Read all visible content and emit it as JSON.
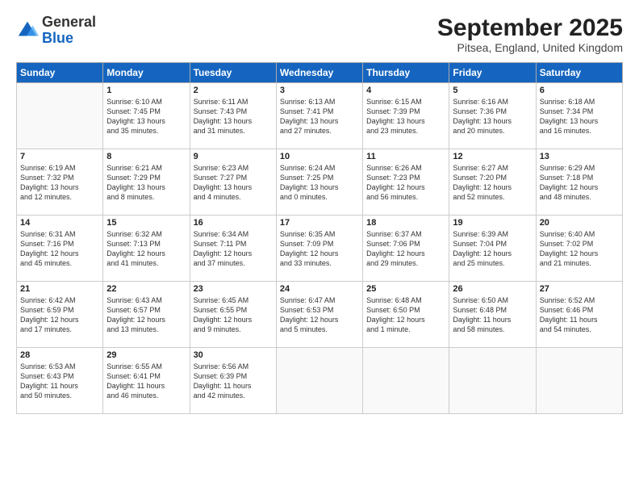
{
  "header": {
    "logo_general": "General",
    "logo_blue": "Blue",
    "month_title": "September 2025",
    "subtitle": "Pitsea, England, United Kingdom"
  },
  "weekdays": [
    "Sunday",
    "Monday",
    "Tuesday",
    "Wednesday",
    "Thursday",
    "Friday",
    "Saturday"
  ],
  "weeks": [
    [
      {
        "day": "",
        "lines": []
      },
      {
        "day": "1",
        "lines": [
          "Sunrise: 6:10 AM",
          "Sunset: 7:45 PM",
          "Daylight: 13 hours",
          "and 35 minutes."
        ]
      },
      {
        "day": "2",
        "lines": [
          "Sunrise: 6:11 AM",
          "Sunset: 7:43 PM",
          "Daylight: 13 hours",
          "and 31 minutes."
        ]
      },
      {
        "day": "3",
        "lines": [
          "Sunrise: 6:13 AM",
          "Sunset: 7:41 PM",
          "Daylight: 13 hours",
          "and 27 minutes."
        ]
      },
      {
        "day": "4",
        "lines": [
          "Sunrise: 6:15 AM",
          "Sunset: 7:39 PM",
          "Daylight: 13 hours",
          "and 23 minutes."
        ]
      },
      {
        "day": "5",
        "lines": [
          "Sunrise: 6:16 AM",
          "Sunset: 7:36 PM",
          "Daylight: 13 hours",
          "and 20 minutes."
        ]
      },
      {
        "day": "6",
        "lines": [
          "Sunrise: 6:18 AM",
          "Sunset: 7:34 PM",
          "Daylight: 13 hours",
          "and 16 minutes."
        ]
      }
    ],
    [
      {
        "day": "7",
        "lines": [
          "Sunrise: 6:19 AM",
          "Sunset: 7:32 PM",
          "Daylight: 13 hours",
          "and 12 minutes."
        ]
      },
      {
        "day": "8",
        "lines": [
          "Sunrise: 6:21 AM",
          "Sunset: 7:29 PM",
          "Daylight: 13 hours",
          "and 8 minutes."
        ]
      },
      {
        "day": "9",
        "lines": [
          "Sunrise: 6:23 AM",
          "Sunset: 7:27 PM",
          "Daylight: 13 hours",
          "and 4 minutes."
        ]
      },
      {
        "day": "10",
        "lines": [
          "Sunrise: 6:24 AM",
          "Sunset: 7:25 PM",
          "Daylight: 13 hours",
          "and 0 minutes."
        ]
      },
      {
        "day": "11",
        "lines": [
          "Sunrise: 6:26 AM",
          "Sunset: 7:23 PM",
          "Daylight: 12 hours",
          "and 56 minutes."
        ]
      },
      {
        "day": "12",
        "lines": [
          "Sunrise: 6:27 AM",
          "Sunset: 7:20 PM",
          "Daylight: 12 hours",
          "and 52 minutes."
        ]
      },
      {
        "day": "13",
        "lines": [
          "Sunrise: 6:29 AM",
          "Sunset: 7:18 PM",
          "Daylight: 12 hours",
          "and 48 minutes."
        ]
      }
    ],
    [
      {
        "day": "14",
        "lines": [
          "Sunrise: 6:31 AM",
          "Sunset: 7:16 PM",
          "Daylight: 12 hours",
          "and 45 minutes."
        ]
      },
      {
        "day": "15",
        "lines": [
          "Sunrise: 6:32 AM",
          "Sunset: 7:13 PM",
          "Daylight: 12 hours",
          "and 41 minutes."
        ]
      },
      {
        "day": "16",
        "lines": [
          "Sunrise: 6:34 AM",
          "Sunset: 7:11 PM",
          "Daylight: 12 hours",
          "and 37 minutes."
        ]
      },
      {
        "day": "17",
        "lines": [
          "Sunrise: 6:35 AM",
          "Sunset: 7:09 PM",
          "Daylight: 12 hours",
          "and 33 minutes."
        ]
      },
      {
        "day": "18",
        "lines": [
          "Sunrise: 6:37 AM",
          "Sunset: 7:06 PM",
          "Daylight: 12 hours",
          "and 29 minutes."
        ]
      },
      {
        "day": "19",
        "lines": [
          "Sunrise: 6:39 AM",
          "Sunset: 7:04 PM",
          "Daylight: 12 hours",
          "and 25 minutes."
        ]
      },
      {
        "day": "20",
        "lines": [
          "Sunrise: 6:40 AM",
          "Sunset: 7:02 PM",
          "Daylight: 12 hours",
          "and 21 minutes."
        ]
      }
    ],
    [
      {
        "day": "21",
        "lines": [
          "Sunrise: 6:42 AM",
          "Sunset: 6:59 PM",
          "Daylight: 12 hours",
          "and 17 minutes."
        ]
      },
      {
        "day": "22",
        "lines": [
          "Sunrise: 6:43 AM",
          "Sunset: 6:57 PM",
          "Daylight: 12 hours",
          "and 13 minutes."
        ]
      },
      {
        "day": "23",
        "lines": [
          "Sunrise: 6:45 AM",
          "Sunset: 6:55 PM",
          "Daylight: 12 hours",
          "and 9 minutes."
        ]
      },
      {
        "day": "24",
        "lines": [
          "Sunrise: 6:47 AM",
          "Sunset: 6:53 PM",
          "Daylight: 12 hours",
          "and 5 minutes."
        ]
      },
      {
        "day": "25",
        "lines": [
          "Sunrise: 6:48 AM",
          "Sunset: 6:50 PM",
          "Daylight: 12 hours",
          "and 1 minute."
        ]
      },
      {
        "day": "26",
        "lines": [
          "Sunrise: 6:50 AM",
          "Sunset: 6:48 PM",
          "Daylight: 11 hours",
          "and 58 minutes."
        ]
      },
      {
        "day": "27",
        "lines": [
          "Sunrise: 6:52 AM",
          "Sunset: 6:46 PM",
          "Daylight: 11 hours",
          "and 54 minutes."
        ]
      }
    ],
    [
      {
        "day": "28",
        "lines": [
          "Sunrise: 6:53 AM",
          "Sunset: 6:43 PM",
          "Daylight: 11 hours",
          "and 50 minutes."
        ]
      },
      {
        "day": "29",
        "lines": [
          "Sunrise: 6:55 AM",
          "Sunset: 6:41 PM",
          "Daylight: 11 hours",
          "and 46 minutes."
        ]
      },
      {
        "day": "30",
        "lines": [
          "Sunrise: 6:56 AM",
          "Sunset: 6:39 PM",
          "Daylight: 11 hours",
          "and 42 minutes."
        ]
      },
      {
        "day": "",
        "lines": []
      },
      {
        "day": "",
        "lines": []
      },
      {
        "day": "",
        "lines": []
      },
      {
        "day": "",
        "lines": []
      }
    ]
  ]
}
